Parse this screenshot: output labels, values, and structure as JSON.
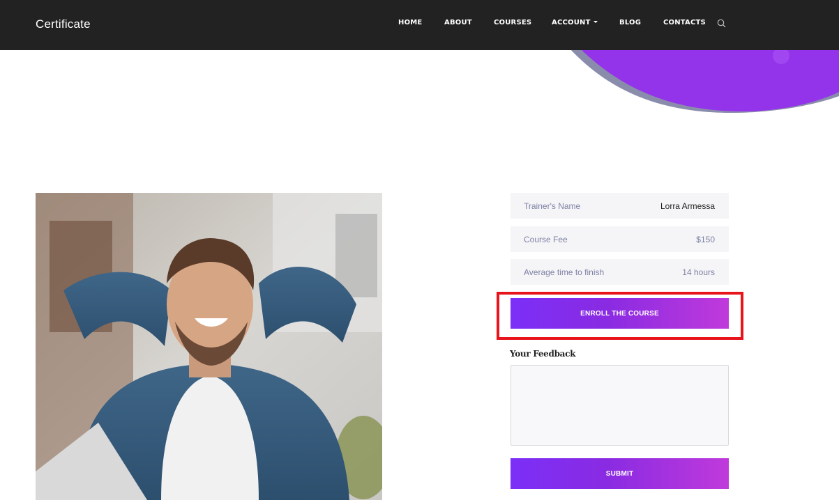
{
  "brand": "Certificate",
  "nav": {
    "home": "HOME",
    "about": "ABOUT",
    "courses": "COURSES",
    "account": "ACCOUNT",
    "blog": "BLOG",
    "contacts": "CONTACTS"
  },
  "icons": {
    "search": "search-icon",
    "dropdown": "caret-down-icon"
  },
  "course_info": {
    "trainer_label": "Trainer's Name",
    "trainer_value": "Lorra Armessa",
    "fee_label": "Course Fee",
    "fee_value": "$150",
    "time_label": "Average time to finish",
    "time_value": "14 hours"
  },
  "enroll_label": "ENROLL THE COURSE",
  "feedback": {
    "label": "Your Feedback",
    "placeholder": "",
    "submit_label": "SUBMIT"
  },
  "colors": {
    "navbar": "#222222",
    "accent_start": "#7b2ff7",
    "accent_end": "#c03adb",
    "highlight": "#e8141c",
    "row_bg": "#f5f5f7"
  }
}
